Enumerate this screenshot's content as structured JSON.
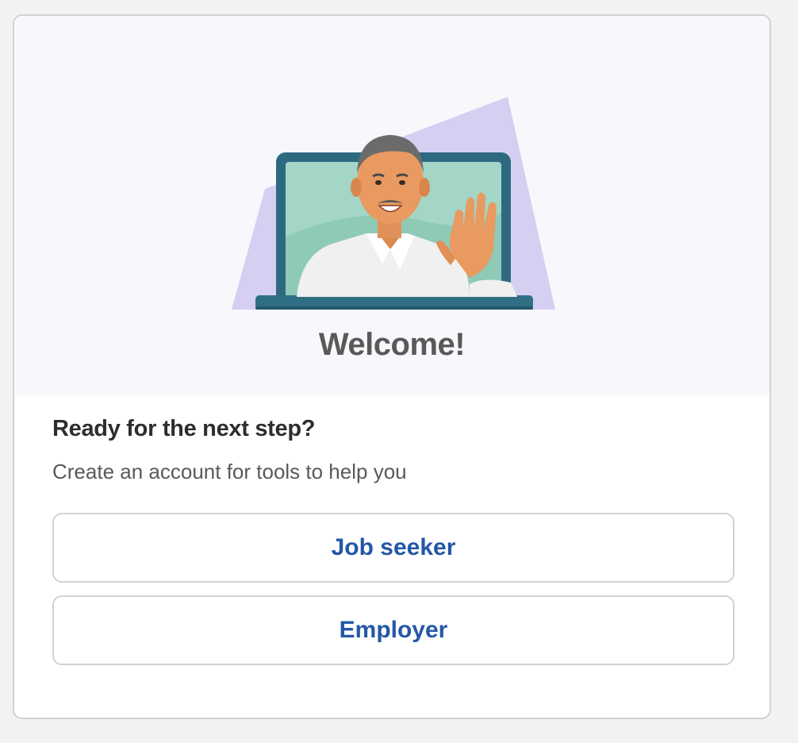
{
  "hero": {
    "title": "Welcome!",
    "illustration": "person-waving-from-laptop-illustration"
  },
  "prompt": {
    "heading": "Ready for the next step?",
    "subtext": "Create an account for tools to help you"
  },
  "actions": {
    "job_seeker_label": "Job seeker",
    "employer_label": "Employer"
  },
  "colors": {
    "page_bg": "#f3f2f1",
    "hero_bg": "#f7f8fc",
    "accent_purple": "#d5cff2",
    "button_text": "#2557a7",
    "laptop": "#2d6a80",
    "screen": "#9fd3c3"
  }
}
